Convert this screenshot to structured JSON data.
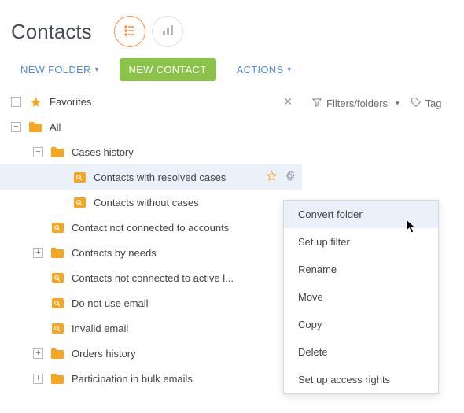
{
  "title": "Contacts",
  "toolbar": {
    "new_folder": "NEW FOLDER",
    "new_contact": "NEW CONTACT",
    "actions": "ACTIONS"
  },
  "right": {
    "filters": "Filters/folders",
    "tag": "Tag"
  },
  "tree": {
    "favorites": "Favorites",
    "all": "All",
    "cases_history": "Cases history",
    "resolved": "Contacts with resolved cases",
    "without": "Contacts without cases",
    "not_connected": "Contact not connected to accounts",
    "by_needs": "Contacts by needs",
    "not_active": "Contacts not connected to active l...",
    "no_email": "Do not use email",
    "invalid": "Invalid email",
    "orders": "Orders history",
    "bulk": "Participation in bulk emails"
  },
  "toggles": {
    "minus": "−",
    "plus": "+"
  },
  "menu": {
    "convert": "Convert folder",
    "setup_filter": "Set up filter",
    "rename": "Rename",
    "move": "Move",
    "copy": "Copy",
    "delete": "Delete",
    "access": "Set up access rights"
  }
}
